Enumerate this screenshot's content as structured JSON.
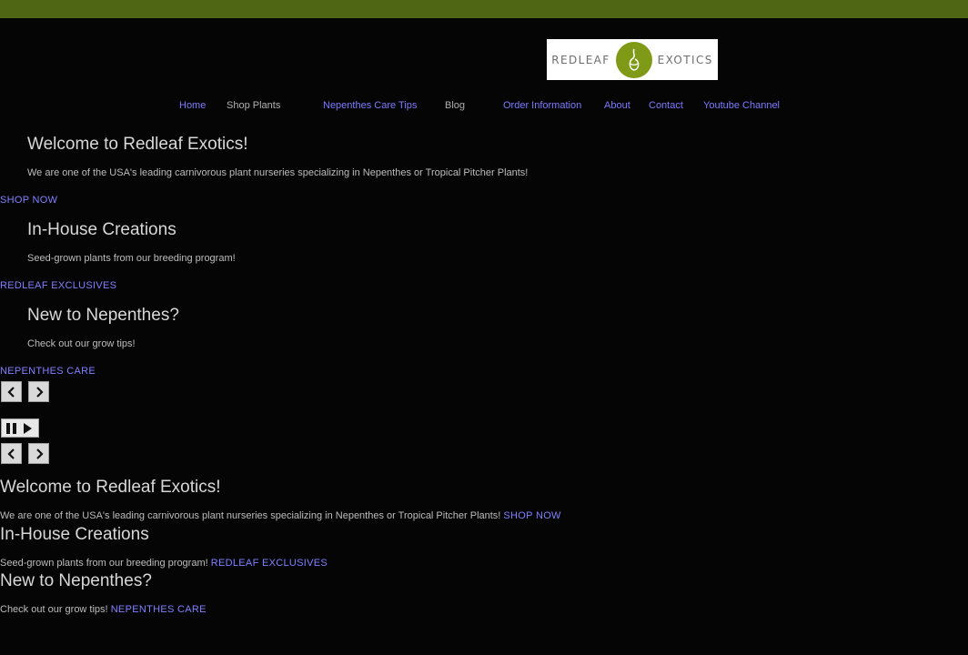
{
  "logo": {
    "left_text": "REDLEAF",
    "right_text": "EXOTICS"
  },
  "nav": {
    "items": [
      {
        "label": "Home"
      },
      {
        "label": "Shop Plants"
      },
      {
        "label": "Nepenthes Care Tips"
      },
      {
        "label": "Blog"
      },
      {
        "label": "Order Information"
      },
      {
        "label": "About"
      },
      {
        "label": "Contact"
      },
      {
        "label": "Youtube Channel"
      }
    ]
  },
  "slides": [
    {
      "title": "Welcome to Redleaf Exotics!",
      "text": "We are one of the USA's leading carnivorous plant nurseries specializing in Nepenthes or Tropical Pitcher Plants!",
      "cta": "SHOP NOW"
    },
    {
      "title": "In-House Creations",
      "text": "Seed-grown plants from our breeding program!",
      "cta": "REDLEAF EXCLUSIVES"
    },
    {
      "title": "New to Nepenthes?",
      "text": "Check out our grow tips!",
      "cta": "NEPENTHES CARE"
    }
  ],
  "controls": {
    "prev_icon": "chevron-left-icon",
    "next_icon": "chevron-right-icon",
    "pause_icon": "pause-play-icon"
  },
  "colors": {
    "topbar": "#4f6614",
    "link": "#7b7bff",
    "background": "#050505"
  }
}
